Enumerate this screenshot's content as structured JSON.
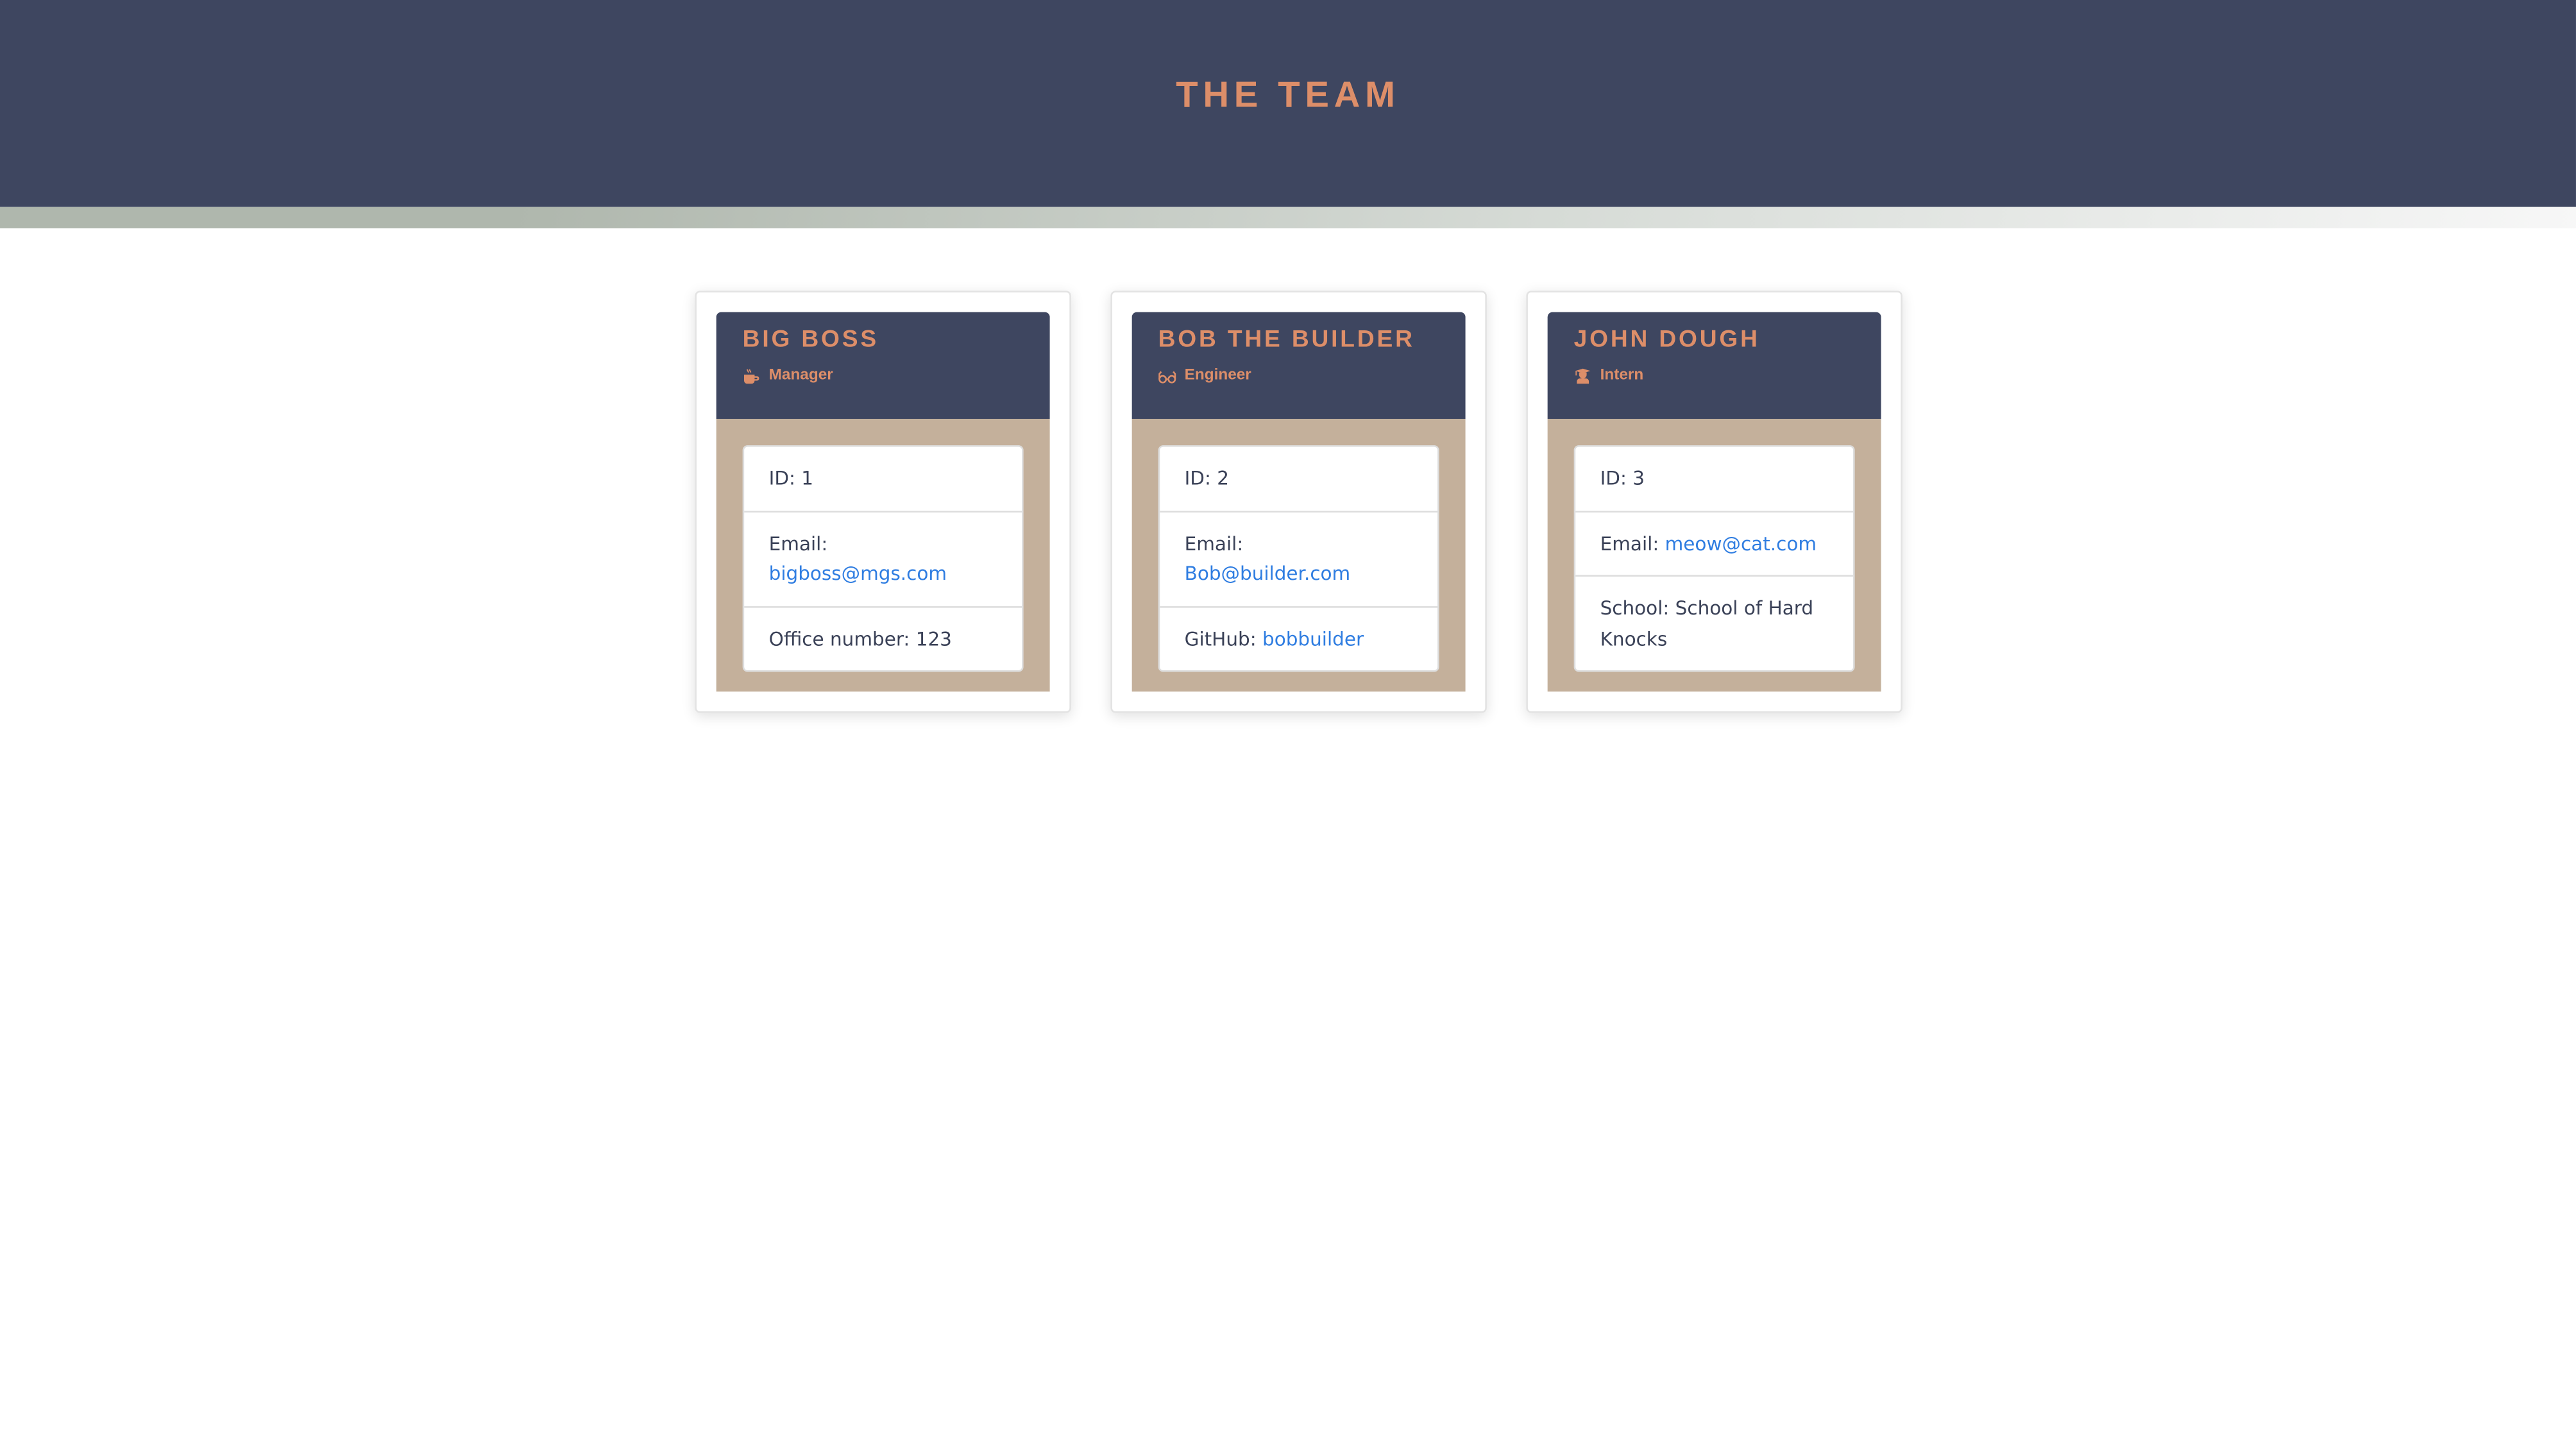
{
  "header": {
    "title": "THE TEAM"
  },
  "colors": {
    "header_bg": "#3e4660",
    "accent": "#dd8e69",
    "card_body": "#c4b09b",
    "link": "#2f7de1"
  },
  "team": [
    {
      "name": "BIG BOSS",
      "role": "Manager",
      "role_icon": "coffee-icon",
      "id_label": "ID: 1",
      "email_label": "Email: ",
      "email": "bigboss@mgs.com",
      "extra_label": "Office number: 123",
      "extra_link": null
    },
    {
      "name": "BOB THE BUILDER",
      "role": "Engineer",
      "role_icon": "glasses-icon",
      "id_label": "ID: 2",
      "email_label": "Email: ",
      "email": "Bob@builder.com",
      "extra_label": "GitHub: ",
      "extra_link": "bobbuilder"
    },
    {
      "name": "JOHN DOUGH",
      "role": "Intern",
      "role_icon": "user-graduate-icon",
      "id_label": "ID: 3",
      "email_label": "Email: ",
      "email": "meow@cat.com",
      "extra_label": "School: School of Hard Knocks",
      "extra_link": null
    }
  ]
}
